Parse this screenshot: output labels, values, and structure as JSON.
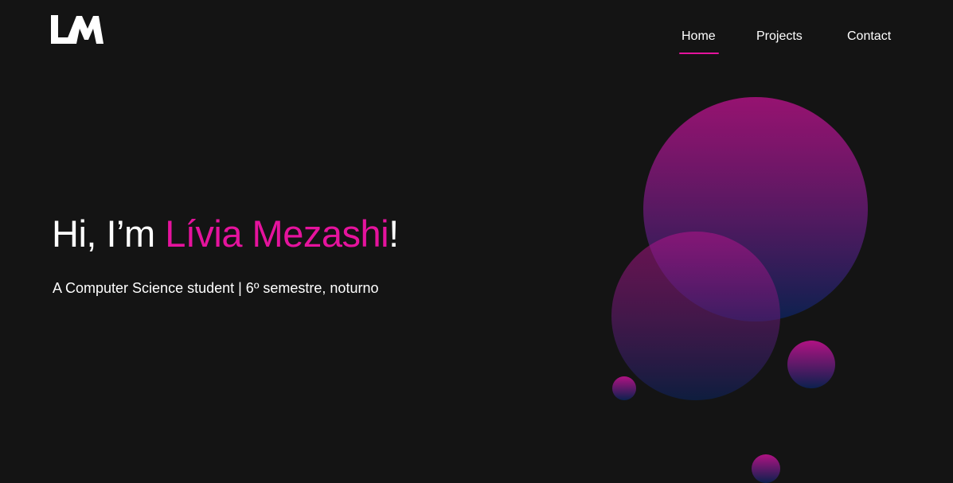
{
  "logo": {
    "text": "LM"
  },
  "nav": {
    "items": [
      {
        "label": "Home",
        "active": true
      },
      {
        "label": "Projects",
        "active": false
      },
      {
        "label": "Contact",
        "active": false
      }
    ]
  },
  "hero": {
    "greeting": "Hi, I’m ",
    "name": "Lívia Mezashi",
    "exclaim": "!",
    "subtitle": "A Computer Science student | 6º semestre, noturno"
  },
  "colors": {
    "background": "#141414",
    "accent": "#e5139d",
    "bubble_top": "#c1128f",
    "bubble_bottom": "#0b2255",
    "text": "#ffffff"
  }
}
